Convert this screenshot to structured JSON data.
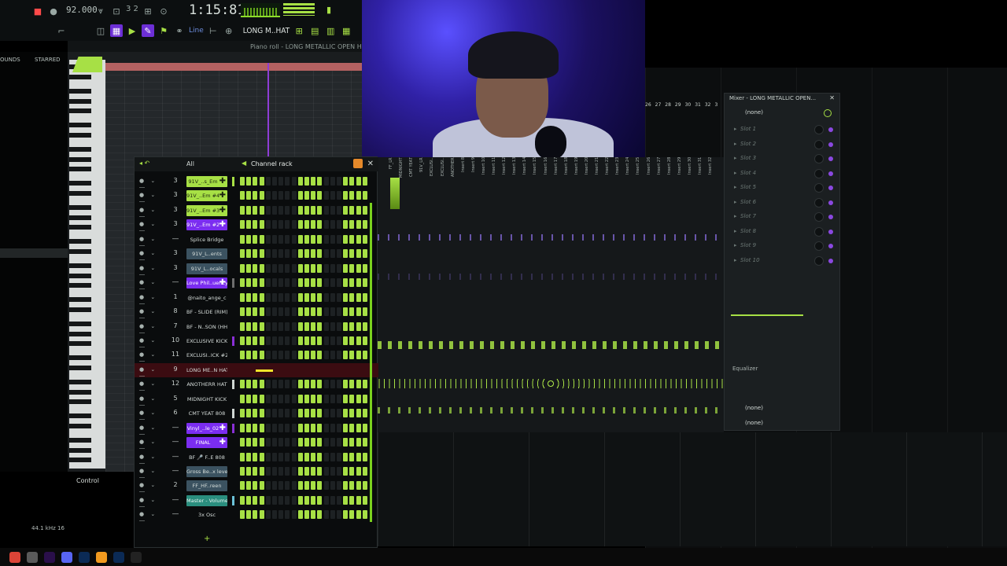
{
  "toolbar": {
    "bpm": "92.000",
    "time_sig": "3 2",
    "song_position": "1:15:81",
    "line_mode": "Line",
    "pattern_name": "LONG M..HAT",
    "piano_roll_title": "Piano roll - LONG METALLIC OPEN H..."
  },
  "browser": {
    "tab_sounds": "OUNDS",
    "tab_starred": "STARRED",
    "sample_rate": "44.1 kHz 16",
    "control_label": "Control"
  },
  "channel_rack": {
    "title": "Channel rack",
    "filter": "All",
    "channels": [
      {
        "route": "3",
        "name": "91V_..s_Em",
        "color": "green",
        "meter": "#a7e045"
      },
      {
        "route": "3",
        "name": "91V_..Em #4",
        "color": "green",
        "meter": ""
      },
      {
        "route": "3",
        "name": "91V_..Em #3",
        "color": "green",
        "meter": ""
      },
      {
        "route": "3",
        "name": "91V_..Em #2",
        "color": "purple",
        "meter": ""
      },
      {
        "route": "",
        "name": "Splice Bridge",
        "color": "dark",
        "meter": ""
      },
      {
        "route": "3",
        "name": "91V_L..ents",
        "color": "grey",
        "meter": ""
      },
      {
        "route": "3",
        "name": "91V_L..ocals",
        "color": "grey",
        "meter": ""
      },
      {
        "route": "",
        "name": "Love Phil..uency",
        "color": "purple",
        "meter": "#6d6d6d"
      },
      {
        "route": "1",
        "name": "@naito_ange_c",
        "color": "dark",
        "meter": ""
      },
      {
        "route": "8",
        "name": "BF - SLIDE (RIM)",
        "color": "dark",
        "meter": ""
      },
      {
        "route": "7",
        "name": "BF - N..SON (HH)",
        "color": "dark",
        "meter": ""
      },
      {
        "route": "10",
        "name": "EXCLUSIVE KICK",
        "color": "dark",
        "meter": "#8a2fd6"
      },
      {
        "route": "11",
        "name": "EXCLUSI..ICK #2",
        "color": "dark",
        "meter": ""
      },
      {
        "route": "9",
        "name": "LONG ME..N HAT",
        "color": "dark",
        "meter": "",
        "piano_roll": true
      },
      {
        "route": "12",
        "name": "ANOTHERR HAT",
        "color": "dark",
        "meter": "#cfd6d2"
      },
      {
        "route": "5",
        "name": "MIDNIGHT KICK",
        "color": "dark",
        "meter": ""
      },
      {
        "route": "6",
        "name": "CMT YEAT 808",
        "color": "dark",
        "meter": "#cfd6d2"
      },
      {
        "route": "",
        "name": "Vinyl_..le_02",
        "color": "purple",
        "meter": "#8a2fd6"
      },
      {
        "route": "",
        "name": "FINAL",
        "color": "purple",
        "meter": ""
      },
      {
        "route": "",
        "name": "BF 🎤 F..E 808",
        "color": "dark",
        "meter": ""
      },
      {
        "route": "",
        "name": "Gross Be..x level",
        "color": "grey",
        "meter": ""
      },
      {
        "route": "2",
        "name": "FF_HF..reen",
        "color": "grey",
        "meter": ""
      },
      {
        "route": "",
        "name": "Master - Volume",
        "color": "teal",
        "meter": "#6bc2d8"
      },
      {
        "route": "",
        "name": "3x Osc",
        "color": "dark",
        "meter": ""
      }
    ]
  },
  "mixer": {
    "panel_title": "Mixer - LONG METALLIC OPEN...",
    "input": "(none)",
    "slots": [
      "Slot 1",
      "Slot 2",
      "Slot 3",
      "Slot 4",
      "Slot 5",
      "Slot 6",
      "Slot 7",
      "Slot 8",
      "Slot 9",
      "Slot 10"
    ],
    "equalizer_label": "Equalizer",
    "route_out_1": "(none)",
    "route_out_2": "(none)",
    "insert_labels": [
      "FF_LR",
      "MIDNIGHT",
      "CMT YEAT",
      "91V_LR",
      "EXCLUSI..",
      "EXCLUSI..",
      "ANOTHER",
      "Insert 8",
      "Insert 9",
      "Insert 10",
      "Insert 11",
      "Insert 12",
      "Insert 13",
      "Insert 14",
      "Insert 15",
      "Insert 16",
      "Insert 17",
      "Insert 18",
      "Insert 19",
      "Insert 20",
      "Insert 21",
      "Insert 22",
      "Insert 23",
      "Insert 24",
      "Insert 25",
      "Insert 26",
      "Insert 27",
      "Insert 28",
      "Insert 29",
      "Insert 30",
      "Insert 31",
      "Insert 32"
    ],
    "column_numbers": [
      "26",
      "27",
      "28",
      "29",
      "30",
      "31",
      "32",
      "3"
    ]
  },
  "colors": {
    "accent_green": "#a7e045",
    "accent_purple": "#7b2df0"
  },
  "taskbar": {
    "apps": [
      "chrome-icon",
      "obs-icon",
      "premiere-icon",
      "discord-icon",
      "photoshop-icon",
      "fl-studio-icon",
      "photoshop-alt-icon",
      "capcut-icon"
    ]
  }
}
